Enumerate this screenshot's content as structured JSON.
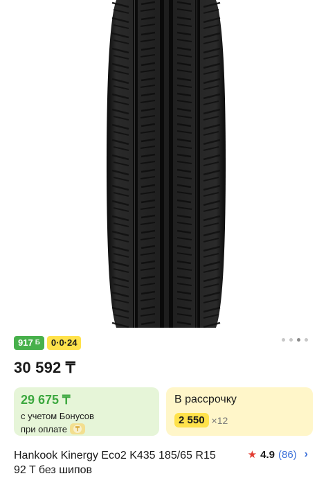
{
  "gallery": {
    "image_alt_icon": "tire-image",
    "dots": 4,
    "active_dot": 3
  },
  "badges": {
    "bonus_value": "917",
    "bonus_icon": "Б",
    "installment_plan": "0·0·24"
  },
  "price": "30 592 ₸",
  "bonus_card": {
    "price": "29 675 ₸",
    "line1": "с учетом Бонусов",
    "line2": "при оплате",
    "pay_icon": "₸"
  },
  "installment_card": {
    "title": "В рассрочку",
    "amount": "2 550",
    "multiplier": "×12"
  },
  "product": {
    "title": "Hankook Kinergy Eco2 K435 185/65 R15 92 T без шипов"
  },
  "rating": {
    "value": "4.9",
    "count": "(86)"
  },
  "colors": {
    "bonus_green": "#47b04b",
    "installment_yellow": "#ffe24b",
    "link_blue": "#3a6fd8",
    "star_red": "#e23b30"
  }
}
